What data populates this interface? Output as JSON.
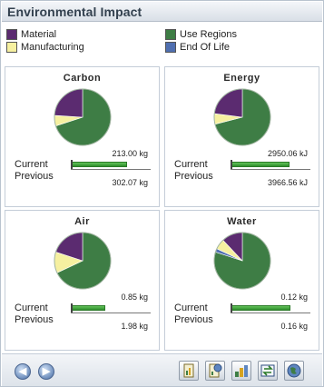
{
  "window": {
    "title": "Environmental Impact"
  },
  "legend": [
    {
      "label": "Material",
      "color": "#5b2b70"
    },
    {
      "label": "Manufacturing",
      "color": "#f6f0a0"
    },
    {
      "label": "Use Regions",
      "color": "#3e7d45"
    },
    {
      "label": "End Of Life",
      "color": "#4f6fb0"
    }
  ],
  "panels": [
    {
      "title": "Carbon",
      "current_label": "Current",
      "previous_label": "Previous",
      "current_value": "213.00 kg",
      "previous_value": "302.07 kg",
      "current_fraction": 0.71,
      "pie": [
        {
          "category": "Use Regions",
          "share": 0.7
        },
        {
          "category": "Manufacturing",
          "share": 0.06
        },
        {
          "category": "Material",
          "share": 0.24
        }
      ]
    },
    {
      "title": "Energy",
      "current_label": "Current",
      "previous_label": "Previous",
      "current_value": "2950.06 kJ",
      "previous_value": "3966.56 kJ",
      "current_fraction": 0.74,
      "pie": [
        {
          "category": "Use Regions",
          "share": 0.71
        },
        {
          "category": "Manufacturing",
          "share": 0.06
        },
        {
          "category": "Material",
          "share": 0.23
        }
      ]
    },
    {
      "title": "Air",
      "current_label": "Current",
      "previous_label": "Previous",
      "current_value": "0.85 kg",
      "previous_value": "1.98 kg",
      "current_fraction": 0.43,
      "pie": [
        {
          "category": "Use Regions",
          "share": 0.68
        },
        {
          "category": "Manufacturing",
          "share": 0.12
        },
        {
          "category": "Material",
          "share": 0.2
        }
      ]
    },
    {
      "title": "Water",
      "current_label": "Current",
      "previous_label": "Previous",
      "current_value": "0.12 kg",
      "previous_value": "0.16 kg",
      "current_fraction": 0.75,
      "pie": [
        {
          "category": "Use Regions",
          "share": 0.8
        },
        {
          "category": "End Of Life",
          "share": 0.02
        },
        {
          "category": "Manufacturing",
          "share": 0.06
        },
        {
          "category": "Material",
          "share": 0.12
        }
      ]
    }
  ],
  "toolbar": {
    "nav_buttons": [
      {
        "icon": "arrow-left-icon",
        "glyph": "◀"
      },
      {
        "icon": "arrow-right-icon",
        "glyph": "▶"
      }
    ],
    "tools": [
      {
        "icon": "report-icon"
      },
      {
        "icon": "report-settings-icon"
      },
      {
        "icon": "material-chart-icon"
      },
      {
        "icon": "swap-icon"
      },
      {
        "icon": "globe-icon"
      }
    ]
  },
  "colors": {
    "material": "#5b2b70",
    "manufacturing": "#f6f0a0",
    "use_regions": "#3e7d45",
    "end_of_life": "#4f6fb0",
    "bar": "#2f8f2c"
  }
}
